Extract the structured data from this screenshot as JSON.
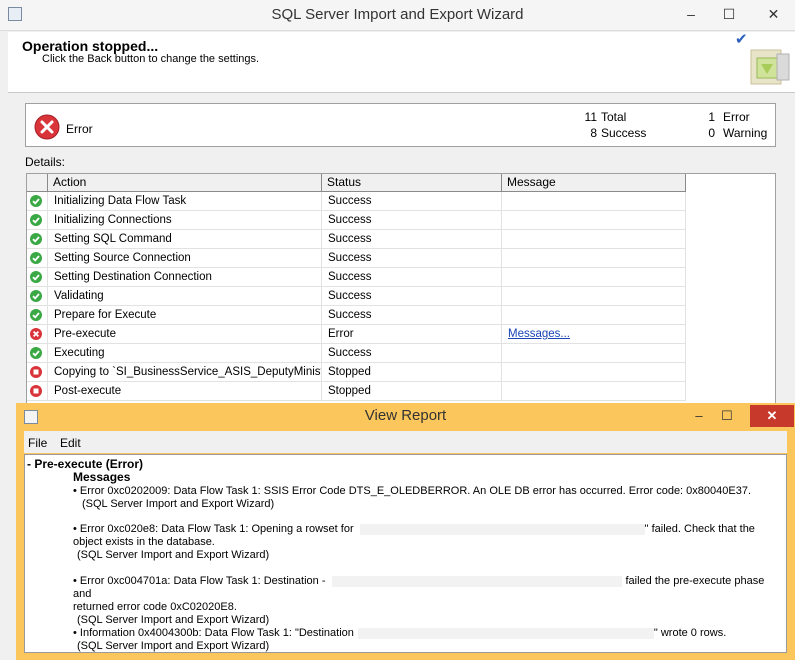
{
  "window": {
    "title": "SQL Server Import and Export Wizard",
    "minimize": "–",
    "maximize": "☐",
    "close": "✕"
  },
  "header": {
    "title": "Operation stopped...",
    "subtitle": "Click the Back button to change the settings.",
    "check": "✔"
  },
  "summary": {
    "status_label": "Error",
    "total_count": "11",
    "total_label": "Total",
    "success_count": "8",
    "success_label": "Success",
    "error_count": "1",
    "error_label": "Error",
    "warning_count": "0",
    "warning_label": "Warning"
  },
  "details": {
    "label": "Details:",
    "columns": [
      "Action",
      "Status",
      "Message"
    ],
    "rows": [
      {
        "action": "Initializing Data Flow Task",
        "status": "Success",
        "message": "",
        "icon": "success-icon"
      },
      {
        "action": "Initializing Connections",
        "status": "Success",
        "message": "",
        "icon": "success-icon"
      },
      {
        "action": "Setting SQL Command",
        "status": "Success",
        "message": "",
        "icon": "success-icon"
      },
      {
        "action": "Setting Source Connection",
        "status": "Success",
        "message": "",
        "icon": "success-icon"
      },
      {
        "action": "Setting Destination Connection",
        "status": "Success",
        "message": "",
        "icon": "success-icon"
      },
      {
        "action": "Validating",
        "status": "Success",
        "message": "",
        "icon": "success-icon"
      },
      {
        "action": "Prepare for Execute",
        "status": "Success",
        "message": "",
        "icon": "success-icon"
      },
      {
        "action": "Pre-execute",
        "status": "Error",
        "message": "Messages...",
        "icon": "error-icon"
      },
      {
        "action": "Executing",
        "status": "Success",
        "message": "",
        "icon": "success-icon"
      },
      {
        "action": "Copying to `SI_BusinessService_ASIS_DeputyMinist...",
        "status": "Stopped",
        "message": "",
        "icon": "stopped-icon"
      },
      {
        "action": "Post-execute",
        "status": "Stopped",
        "message": "",
        "icon": "stopped-icon"
      }
    ]
  },
  "report": {
    "title": "View Report",
    "minimize": "–",
    "maximize": "☐",
    "close": "✕",
    "menu": [
      "File",
      "Edit"
    ],
    "section_title": "- Pre-execute (Error)",
    "messages_heading": "Messages",
    "items": [
      {
        "a": "• Error 0xc0202009: Data Flow Task 1: SSIS Error Code DTS_E_OLEDBERROR.  An OLE DB error has occurred. Error code: 0x80040E37.",
        "b": "",
        "c": "",
        "source": "(SQL Server Import and Export Wizard)"
      },
      {
        "a": "• Error 0xc020e8: Data Flow Task 1: Opening a rowset for",
        "b": "\" failed. Check that the",
        "c": "object exists in the database.",
        "source": "(SQL Server Import and Export Wizard)"
      },
      {
        "a": "• Error 0xc004701a: Data Flow Task 1: Destination -",
        "b": "failed the pre-execute phase and",
        "c": "returned error code 0xC02020E8.",
        "source": "(SQL Server Import and Export Wizard)"
      },
      {
        "a": "• Information 0x4004300b: Data Flow Task 1: \"Destination",
        "b": "\" wrote 0 rows.",
        "c": "",
        "source": "(SQL Server Import and Export Wizard)"
      }
    ]
  },
  "colors": {
    "dialog_frame": "#fbc75c",
    "close_button": "#c7392b",
    "link": "#1a44b8",
    "success": "#3aa845",
    "error": "#d8343a"
  }
}
